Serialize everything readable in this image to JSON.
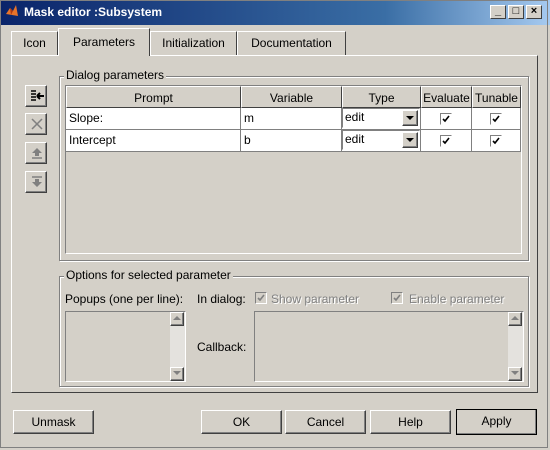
{
  "window": {
    "title": "Mask editor :Subsystem",
    "controls": {
      "minimize": "_",
      "maximize": "□",
      "close": "×"
    }
  },
  "tabs": [
    {
      "label": "Icon"
    },
    {
      "label": "Parameters"
    },
    {
      "label": "Initialization"
    },
    {
      "label": "Documentation"
    }
  ],
  "active_tab": "Parameters",
  "dialog_params": {
    "group_label": "Dialog parameters",
    "columns": [
      "Prompt",
      "Variable",
      "Type",
      "Evaluate",
      "Tunable"
    ],
    "rows": [
      {
        "prompt": "Slope:",
        "variable": "m",
        "type": "edit",
        "evaluate": true,
        "tunable": true
      },
      {
        "prompt": "Intercept",
        "variable": "b",
        "type": "edit",
        "evaluate": true,
        "tunable": true
      }
    ],
    "side_buttons": [
      "add-parameter-icon",
      "delete-parameter-icon",
      "move-up-icon",
      "move-down-icon"
    ]
  },
  "options": {
    "group_label": "Options for selected parameter",
    "popups_label": "Popups (one per line):",
    "in_dialog_label": "In dialog:",
    "show_parameter_label": "Show parameter",
    "enable_parameter_label": "Enable parameter",
    "callback_label": "Callback:"
  },
  "buttons": {
    "unmask": "Unmask",
    "ok": "OK",
    "cancel": "Cancel",
    "help": "Help",
    "apply": "Apply"
  },
  "colors": {
    "face": "#d4d0c8",
    "title_start": "#0a246a",
    "title_end": "#a6caf0"
  }
}
